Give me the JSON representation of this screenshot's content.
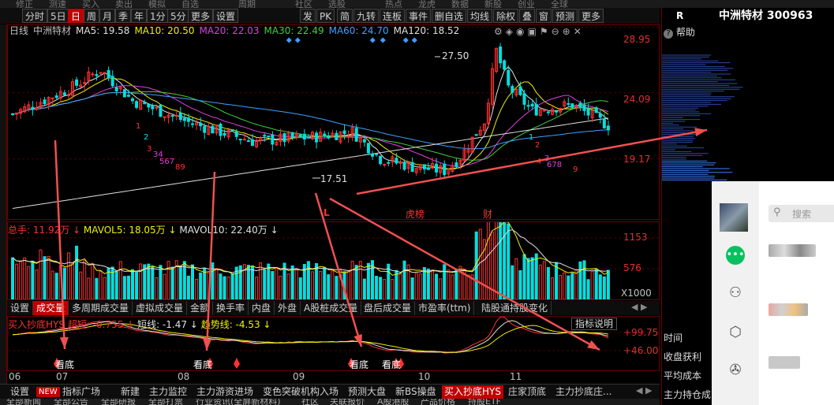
{
  "top_menu": [
    "修正",
    "测速",
    "买入",
    "卖出",
    "模拟",
    "自选",
    "",
    "周期",
    "",
    "社区",
    "选股",
    "",
    "热点",
    "龙虎",
    "数据",
    "新股",
    "创业",
    "全球"
  ],
  "toolbar": {
    "left_items": [
      {
        "label": "分时",
        "active": false
      },
      {
        "label": "5日",
        "active": false
      },
      {
        "label": "日",
        "active": true
      },
      {
        "label": "周",
        "active": false
      },
      {
        "label": "月",
        "active": false
      },
      {
        "label": "季",
        "active": false
      },
      {
        "label": "年",
        "active": false
      },
      {
        "label": "1分",
        "active": false
      },
      {
        "label": "5分",
        "active": false
      },
      {
        "label": "更多",
        "active": false
      },
      {
        "label": "设置",
        "active": false
      }
    ],
    "right_items": [
      "发",
      "PK",
      "简",
      "九转",
      "连板",
      "事件",
      "删自选",
      "均线",
      "除权",
      "叠",
      "窗",
      "预测",
      "更多"
    ]
  },
  "stock": {
    "name": "中洲特材",
    "code": "300963",
    "header": "中洲特材 300963",
    "r_label": "R",
    "help": "帮助"
  },
  "ma_legend": [
    {
      "label": "日线",
      "color": "#c0c0c0"
    },
    {
      "label": "中洲特材",
      "color": "#c0c0c0"
    },
    {
      "label": "MA5: 19.58",
      "color": "#e0e0e0"
    },
    {
      "label": "MA10: 20.50",
      "color": "#f0f000"
    },
    {
      "label": "MA20: 22.03",
      "color": "#e040e0"
    },
    {
      "label": "MA30: 22.49",
      "color": "#40d040"
    },
    {
      "label": "MA60: 24.70",
      "color": "#40a0ff"
    },
    {
      "label": "MA120: 18.52",
      "color": "#e0e0e0"
    }
  ],
  "price_axis": [
    "28.95",
    "24.09",
    "19.17"
  ],
  "price_marks": {
    "high": "27.50",
    "low": "17.51"
  },
  "event_marks": [
    "L",
    "龙虎榜",
    "财"
  ],
  "vol_legend": {
    "total": "总手: 11.92万",
    "mavol5": "MAVOL5: 18.05万",
    "mavol10": "MAVOL10: 22.40万"
  },
  "vol_axis": [
    "1153",
    "576",
    "X1000"
  ],
  "sub_tabs": [
    {
      "label": "设置",
      "active": false
    },
    {
      "label": "成交量",
      "active": true
    },
    {
      "label": "多周期成交量",
      "active": false
    },
    {
      "label": "虚拟成交量",
      "active": false
    },
    {
      "label": "金额",
      "active": false
    },
    {
      "label": "换手率",
      "active": false
    },
    {
      "label": "内盘",
      "active": false
    },
    {
      "label": "外盘",
      "active": false
    },
    {
      "label": "A股桩成交量",
      "active": false
    },
    {
      "label": "盘后成交量",
      "active": false
    },
    {
      "label": "市盈率(ttm)",
      "active": false
    },
    {
      "label": "陆股通持股变化",
      "active": false
    }
  ],
  "ind_legend": {
    "name": "买入抄底HYS",
    "super": "超短: -0.755",
    "short": "短线: -1.47",
    "trend": "趋势线: -4.53",
    "explain": "指标说明"
  },
  "ind_axis": [
    "+99.75",
    "+46.00"
  ],
  "ind_labels": [
    "看底",
    "看底",
    "看底",
    "看底"
  ],
  "date_axis": [
    "06",
    "07",
    "08",
    "09",
    "10",
    "11"
  ],
  "bottom_tabs": [
    {
      "label": "设置",
      "active": false
    },
    {
      "label": "NEW",
      "active": false,
      "badge": true
    },
    {
      "label": "指标广场",
      "active": false
    },
    {
      "label": "新建",
      "active": false
    },
    {
      "label": "主力监控",
      "active": false
    },
    {
      "label": "主力游资进场",
      "active": false
    },
    {
      "label": "变色突破机构入场",
      "active": false
    },
    {
      "label": "预测大盘",
      "active": false
    },
    {
      "label": "新BS操盘",
      "active": false
    },
    {
      "label": "买入抄底HYS",
      "active": true
    },
    {
      "label": "庄家顶底",
      "active": false
    },
    {
      "label": "主力抄底庄...",
      "active": false
    }
  ],
  "bottom_row2": [
    "全部新闻",
    "全部公告",
    "全部研报",
    "全部打票",
    "行业资讯(全屏新材料)",
    "社区",
    "关联报价",
    "A股港股",
    "产品价格",
    "持股ETF"
  ],
  "right_panel": {
    "labels": [
      "时间",
      "收盘获利",
      "平均成本",
      "主力持仓成"
    ]
  },
  "popup": {
    "search_placeholder": "搜索"
  },
  "colors": {
    "up": "#ff3030",
    "down": "#00e0e0",
    "accent": "#c00000"
  },
  "chart_data": {
    "type": "candlestick",
    "series": [
      {
        "name": "MA5",
        "values": []
      },
      {
        "name": "MA10",
        "values": []
      }
    ],
    "x": [
      "06",
      "07",
      "08",
      "09",
      "10",
      "11"
    ],
    "y_labels": [
      "28.95",
      "24.09",
      "19.17"
    ],
    "high": 27.5,
    "low": 17.51
  }
}
